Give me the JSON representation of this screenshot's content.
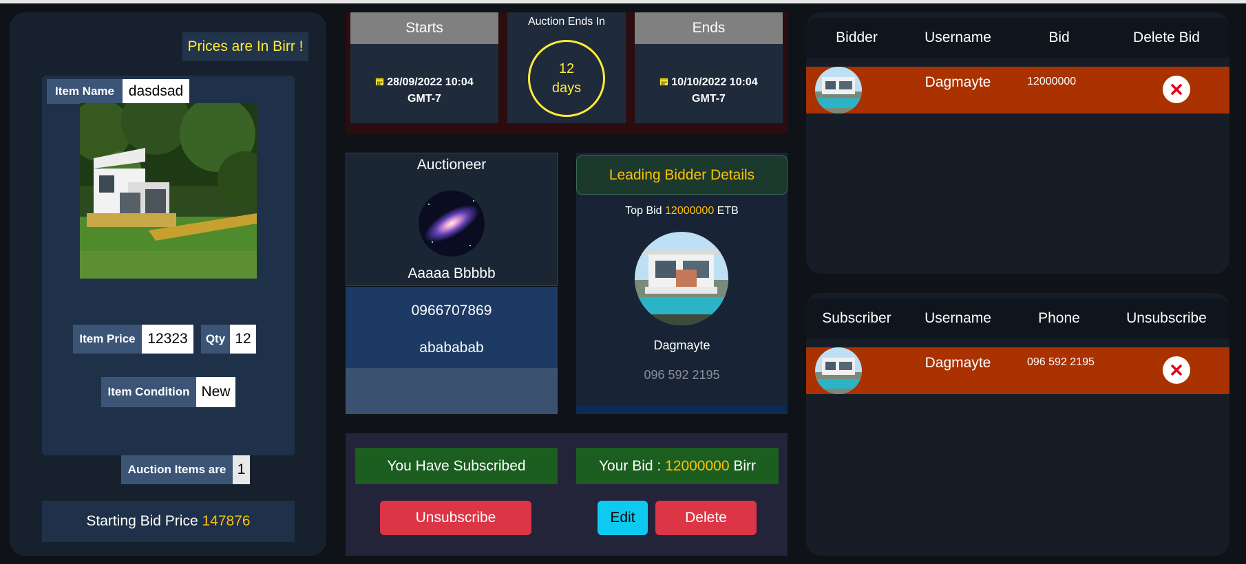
{
  "left": {
    "prices_note": "Prices are In Birr !",
    "item_name_label": "Item Name",
    "item_name_value": "dasdsad",
    "item_price_label": "Item Price",
    "item_price_value": "12323",
    "qty_label": "Qty",
    "qty_value": "12",
    "condition_label": "Item Condition",
    "condition_value": "New",
    "auction_items_label": "Auction Items are",
    "auction_items_value": "1",
    "starting_bid_label": "Starting Bid Price",
    "starting_bid_value": "147876"
  },
  "timing": {
    "starts_label": "Starts",
    "starts_date": "28/09/2022 10:04",
    "starts_tz": "GMT-7",
    "ends_in_label": "Auction Ends In",
    "ends_in_number": "12",
    "ends_in_unit": "days",
    "ends_label": "Ends",
    "ends_date": "10/10/2022 10:04",
    "ends_tz": "GMT-7"
  },
  "auctioneer": {
    "title": "Auctioneer",
    "name": "Aaaaa Bbbbb",
    "phone": "0966707869",
    "extra": "abababab"
  },
  "leading": {
    "title": "Leading Bidder Details",
    "top_bid_prefix": "Top Bid",
    "top_bid_value": "12000000",
    "top_bid_unit": "ETB",
    "name": "Dagmayte",
    "phone": "096 592 2195"
  },
  "actions": {
    "subscribed": "You Have Subscribed",
    "unsubscribe": "Unsubscribe",
    "your_bid_prefix": "Your Bid :",
    "your_bid_value": "12000000",
    "your_bid_unit": "Birr",
    "edit": "Edit",
    "delete": "Delete"
  },
  "bids_table": {
    "headers": [
      "Bidder",
      "Username",
      "Bid",
      "Delete Bid"
    ],
    "rows": [
      {
        "username": "Dagmayte",
        "bid": "12000000"
      }
    ]
  },
  "subs_table": {
    "headers": [
      "Subscriber",
      "Username",
      "Phone",
      "Unsubscribe"
    ],
    "rows": [
      {
        "username": "Dagmayte",
        "phone": "096 592 2195"
      }
    ]
  },
  "colors": {
    "accent_yellow": "#ffc107",
    "row_orange": "#a93200",
    "danger": "#dc3545",
    "success_dark": "#1b5e20",
    "info": "#0dcaf0"
  }
}
